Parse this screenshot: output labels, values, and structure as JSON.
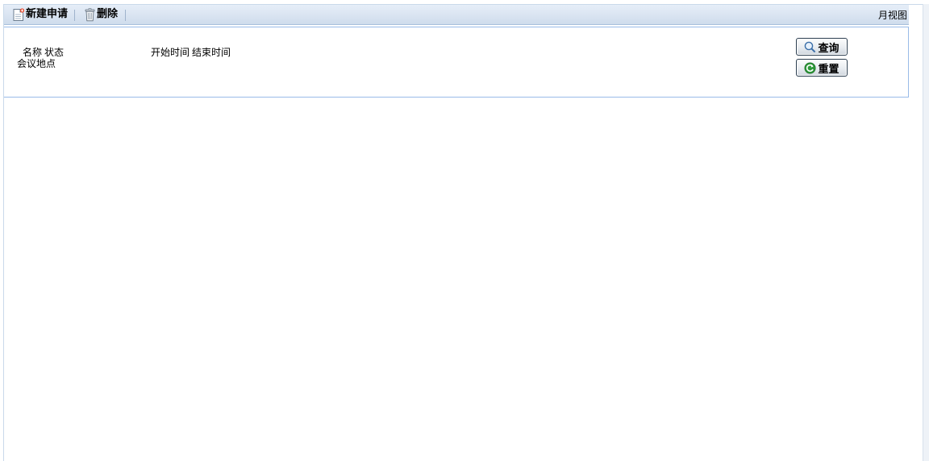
{
  "toolbar": {
    "new_label": "新建申请",
    "delete_label": "删除",
    "month_view_label": "月视图"
  },
  "query": {
    "name_label": "名称",
    "status_label": "状态",
    "place_label": "会议地点",
    "start_label": "开始时间",
    "end_label": "结束时间",
    "query_button": "查询",
    "reset_button": "重置"
  },
  "colors": {
    "toolbar_bg": "#d6e2f0",
    "panel_border": "#99bbe8",
    "reset_icon": "#2e9a3a",
    "query_icon": "#3a6ea8"
  },
  "icons": {
    "new": "new-document-icon",
    "delete": "trash-icon",
    "query": "magnifier-icon",
    "reset": "refresh-icon"
  }
}
